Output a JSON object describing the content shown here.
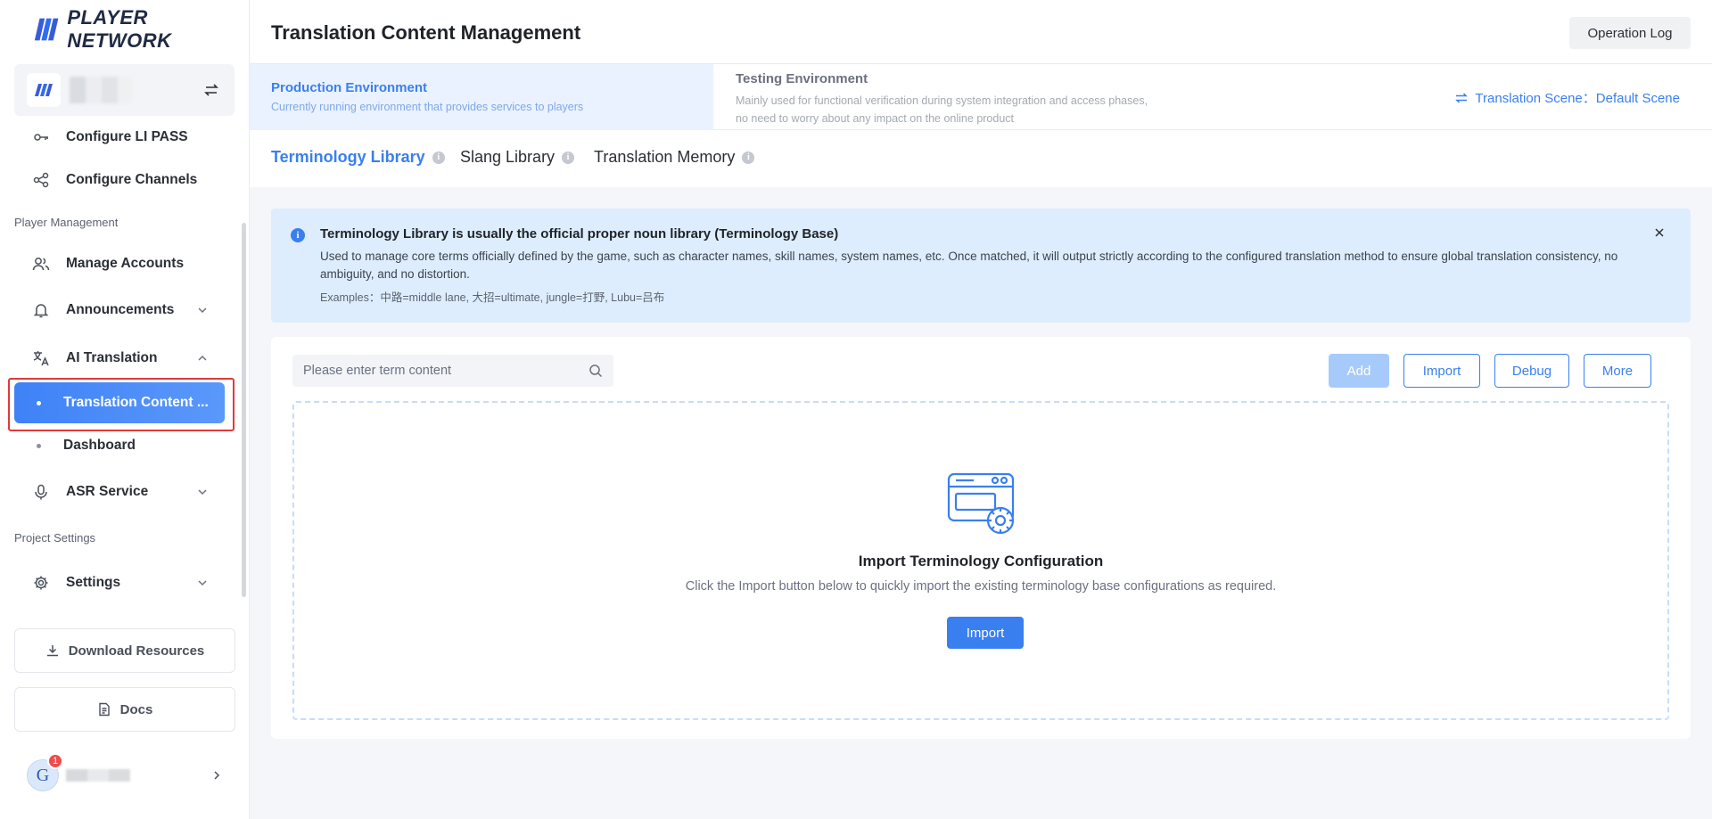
{
  "brand": {
    "name": "PLAYER NETWORK"
  },
  "colors": {
    "accent": "#3a7ff0",
    "highlight": "#e03a3a",
    "notice_bg": "#deedfd"
  },
  "sidebar": {
    "items_top": [
      {
        "label": "Configure LI PASS",
        "icon": "key-icon"
      },
      {
        "label": "Configure Channels",
        "icon": "channels-icon"
      }
    ],
    "section_player": "Player Management",
    "manage_accounts": "Manage Accounts",
    "announcements": "Announcements",
    "ai_translation": "AI Translation",
    "translation_content": "Translation Content ...",
    "dashboard": "Dashboard",
    "asr_service": "ASR Service",
    "section_project": "Project Settings",
    "settings": "Settings",
    "download_resources": "Download Resources",
    "docs": "Docs",
    "user_initial": "G",
    "notification_count": "1"
  },
  "header": {
    "title": "Translation Content Management",
    "operation_log": "Operation Log"
  },
  "environments": {
    "production": {
      "title": "Production Environment",
      "desc": "Currently running environment that provides services to players"
    },
    "testing": {
      "title": "Testing Environment",
      "desc": "Mainly used for functional verification during system integration and access phases, no need to worry about any impact on the online product"
    },
    "scene": "Translation Scene：Default Scene"
  },
  "tabs": [
    {
      "label": "Terminology Library"
    },
    {
      "label": "Slang Library"
    },
    {
      "label": "Translation Memory"
    }
  ],
  "notice": {
    "title": "Terminology Library is usually the official proper noun library (Terminology Base)",
    "desc": "Used to manage core terms officially defined by the game, such as character names, skill names, system names, etc. Once matched, it will output strictly according to the configured translation method to ensure global translation consistency, no ambiguity, and no distortion.",
    "examples": "Examples：中路=middle lane, 大招=ultimate, jungle=打野, Lubu=吕布"
  },
  "toolbar": {
    "search_placeholder": "Please enter term content",
    "add": "Add",
    "import": "Import",
    "debug": "Debug",
    "more": "More"
  },
  "empty_state": {
    "title": "Import Terminology Configuration",
    "desc": "Click the Import button below to quickly import the existing terminology base configurations as required.",
    "button": "Import"
  }
}
